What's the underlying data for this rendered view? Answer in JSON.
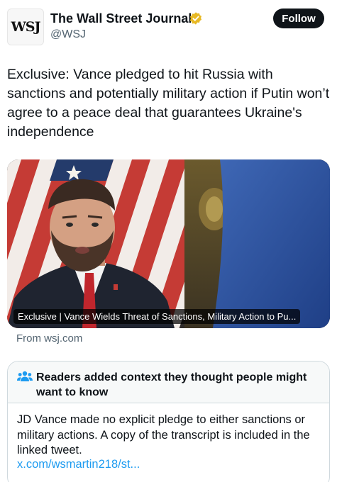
{
  "author": {
    "logo_text": "WSJ",
    "display_name": "The Wall Street Journal",
    "handle": "@WSJ",
    "badge_icon": "verified-gold-badge-icon",
    "badge_color": "#e8b923"
  },
  "follow_button": {
    "label": "Follow"
  },
  "tweet": {
    "text": "Exclusive: Vance pledged to hit Russia with sanctions and potentially military action if Putin won’t agree to a peace deal that guarantees Ukraine's independence"
  },
  "media": {
    "caption": "Exclusive | Vance Wields Threat of Sanctions, Military Action to Pu...",
    "source": "From wsj.com"
  },
  "community_note": {
    "icon": "people-icon",
    "title": "Readers added context they thought people might want to know",
    "body": "JD Vance made no explicit pledge to either sanctions or military actions. A copy of the transcript is included in the linked tweet.",
    "link": "x.com/wsmartin218/st..."
  },
  "colors": {
    "text_primary": "#0f1419",
    "text_secondary": "#536471",
    "link": "#1d9bf0",
    "note_icon": "#1d9bf0",
    "button_bg": "#0f1419"
  }
}
